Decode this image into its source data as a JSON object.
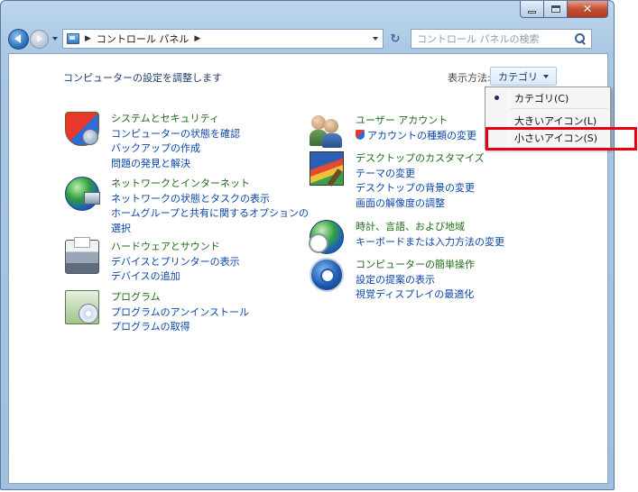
{
  "window": {
    "close_glyph": "✕"
  },
  "navbar": {
    "address_crumbs": [
      "コントロール パネル"
    ],
    "refresh_glyph": "↻",
    "search_placeholder": "コントロール パネルの検索"
  },
  "header": {
    "heading": "コンピューターの設定を調整します",
    "view_label": "表示方法:",
    "view_value": "カテゴリ"
  },
  "categories": [
    {
      "icon": "security-shield-icon",
      "title": "システムとセキュリティ",
      "links": [
        "コンピューターの状態を確認",
        "バックアップの作成",
        "問題の発見と解決"
      ]
    },
    {
      "icon": "network-globe-icon",
      "title": "ネットワークとインターネット",
      "links": [
        "ネットワークの状態とタスクの表示",
        "ホームグループと共有に関するオプションの",
        "選択"
      ]
    },
    {
      "icon": "printer-icon",
      "title": "ハードウェアとサウンド",
      "links": [
        "デバイスとプリンターの表示",
        "デバイスの追加"
      ]
    },
    {
      "icon": "programs-icon",
      "title": "プログラム",
      "links": [
        "プログラムのアンインストール",
        "プログラムの取得"
      ]
    },
    {
      "icon": "user-accounts-icon",
      "title": "ユーザー アカウント",
      "links": [
        "アカウントの種類の変更"
      ]
    },
    {
      "icon": "desktop-paint-icon",
      "title": "デスクトップのカスタマイズ",
      "links": [
        "テーマの変更",
        "デスクトップの背景の変更",
        "画面の解像度の調整"
      ]
    },
    {
      "icon": "clock-globe-icon",
      "title": "時計、言語、および地域",
      "links": [
        "キーボードまたは入力方法の変更"
      ]
    },
    {
      "icon": "ease-of-access-icon",
      "title": "コンピューターの簡単操作",
      "links": [
        "設定の提案の表示",
        "視覚ディスプレイの最適化"
      ]
    }
  ],
  "view_menu": {
    "items": [
      "カテゴリ(C)",
      "大きいアイコン(L)",
      "小さいアイコン(S)"
    ],
    "selected_index": 0,
    "highlighted_index": 2,
    "highlight_color": "#e60012"
  }
}
